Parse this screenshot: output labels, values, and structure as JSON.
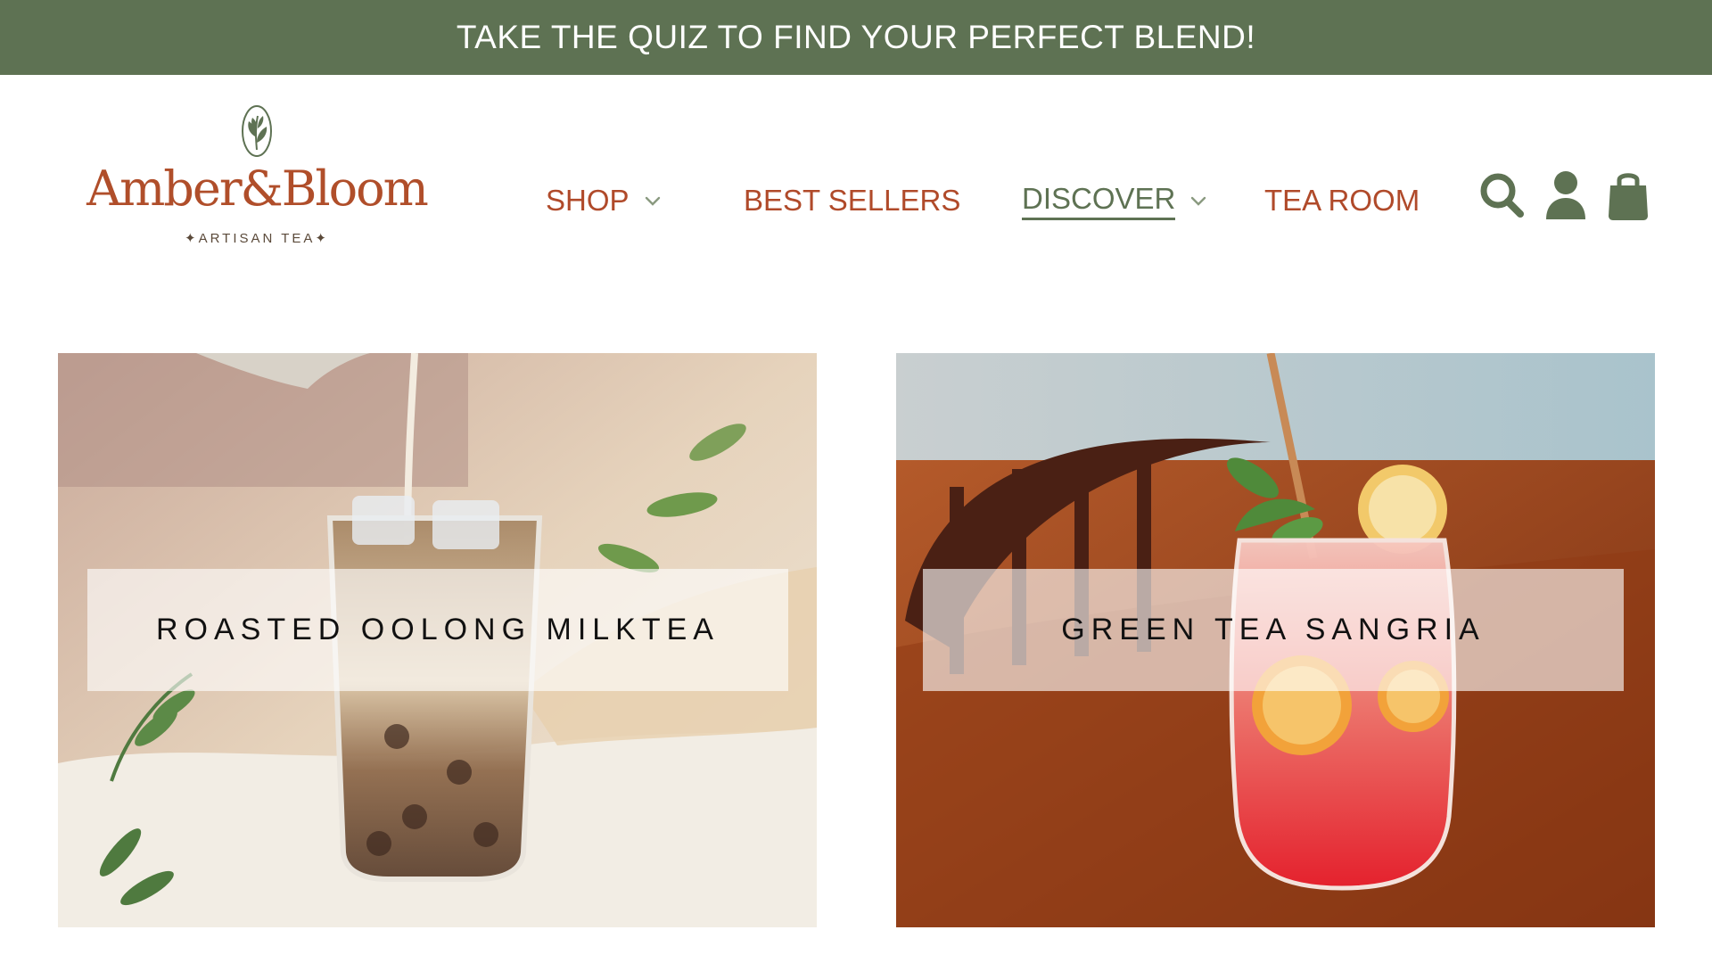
{
  "announcement": {
    "text": "TAKE THE QUIZ TO FIND YOUR PERFECT BLEND!"
  },
  "brand": {
    "name": "Amber&Bloom",
    "tagline": "✦ARTISAN TEA✦",
    "mark_icon": "leaf-sprig-oval-icon",
    "name_color": "#b04e2a",
    "tagline_color": "#5b4a3a"
  },
  "nav": {
    "items": [
      {
        "label": "SHOP",
        "has_dropdown": true,
        "active": false
      },
      {
        "label": "BEST SELLERS",
        "has_dropdown": false,
        "active": false
      },
      {
        "label": "DISCOVER",
        "has_dropdown": true,
        "active": true
      },
      {
        "label": "TEA ROOM",
        "has_dropdown": false,
        "active": false
      }
    ],
    "link_color": "#b04a2a",
    "active_color": "#5e7253"
  },
  "header_icons": [
    {
      "name": "search-icon"
    },
    {
      "name": "account-icon"
    },
    {
      "name": "shopping-bag-icon"
    }
  ],
  "featured": [
    {
      "title": "ROASTED OOLONG MILKTEA",
      "image": "iced-milk-tea-glass-photo"
    },
    {
      "title": "GREEN TEA SANGRIA",
      "image": "red-sangria-glass-photo"
    }
  ],
  "colors": {
    "banner_bg": "#5e7253",
    "banner_text": "#ffffff",
    "icon_green": "#5e7253"
  }
}
